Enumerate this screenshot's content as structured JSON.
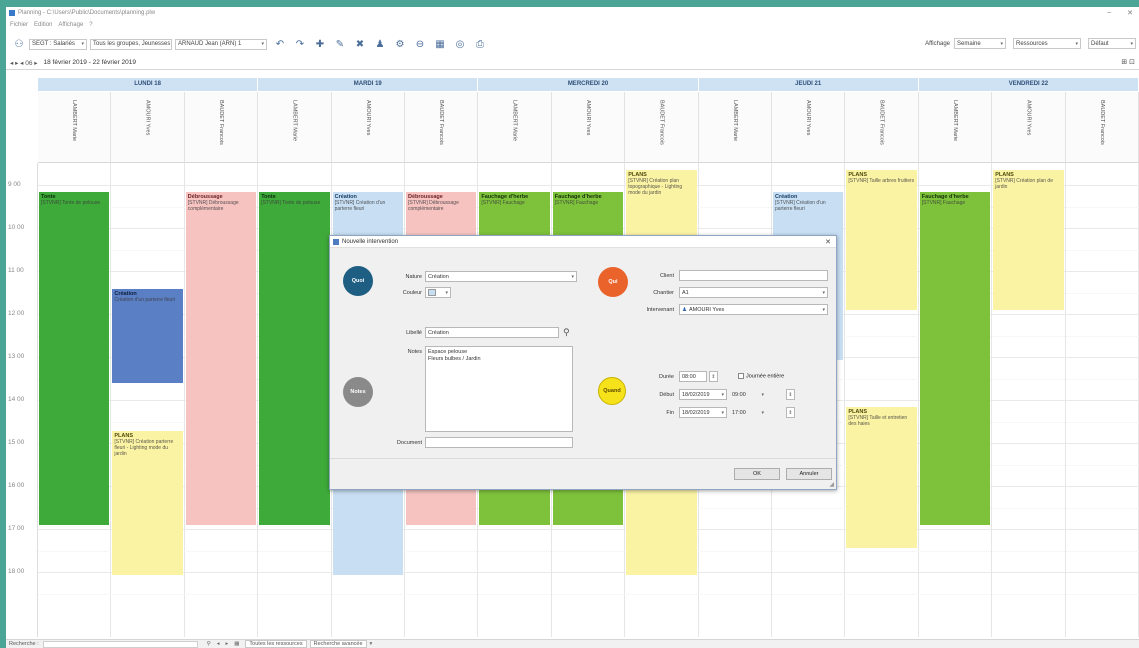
{
  "window": {
    "title": "Planning - C:\\Users\\Public\\Documents\\planning.plw",
    "minimize": "–",
    "close": "✕"
  },
  "menu": [
    "Fichier",
    "Edition",
    "Affichage",
    "?"
  ],
  "toolbar": {
    "combo1": "SEGT : Salariés",
    "combo2": "Tous les groupes, Jeunesses",
    "combo3": "ARNAUD Jean (ARN) 1",
    "right_label": "Affichage",
    "right_combo1": "Semaine",
    "right_combo2": "Ressources",
    "right_combo3": "Défaut"
  },
  "datebar": {
    "nav": "◂ ▸ ◂ 06 ▸",
    "range": "18 février 2019 - 22 février 2019",
    "corner": "⊞ ⊡"
  },
  "days": [
    "LUNDI 18",
    "MARDI 19",
    "MERCREDI 20",
    "JEUDI 21",
    "VENDREDI 22"
  ],
  "resources": [
    "LAMBERT Marie",
    "AMOURI Yves",
    "BAUDET Francois",
    "LAMBERT Marie",
    "AMOURI Yves",
    "BAUDET Francois",
    "LAMBERT Marie",
    "AMOURI Yves",
    "BAUDET Francois",
    "LAMBERT Marie",
    "AMOURI Yves",
    "BAUDET Francois",
    "LAMBERT Marie",
    "AMOURI Yves",
    "BAUDET Francois"
  ],
  "hours": [
    "9 00",
    "10 00",
    "11 00",
    "12 00",
    "13 00",
    "14 00",
    "15 00",
    "16 00",
    "17 00",
    "18 00"
  ],
  "events": {
    "lun_marie": {
      "title": "Tonte",
      "sub": "[STVNR] Tonte de pelouse"
    },
    "lun_yves": {
      "title": "Création",
      "sub": "Création d'un parterre fleuri"
    },
    "lun_yves_plan": {
      "title": "PLANS",
      "sub": "[STVNR] Création parterre fleuri - Lighting mode du jardin"
    },
    "lun_baudet": {
      "title": "Débroussage",
      "sub": "[STVNR] Débroussage complémentaire"
    },
    "mar_marie": {
      "title": "Tonte",
      "sub": "[STVNR] Tonte de pelouse"
    },
    "mar_yves": {
      "title": "Création",
      "sub": "[STVNR] Création d'un parterre fleuri"
    },
    "mar_baudet": {
      "title": "Débroussage",
      "sub": "[STVNR] Débroussage complémentaire"
    },
    "mer_marie": {
      "title": "Fauchage d'herbe",
      "sub": "[STVNR] Fauchage"
    },
    "mer_yves": {
      "title": "Fauchage d'herbe",
      "sub": "[STVNR] Fauchage"
    },
    "mer_baudet": {
      "title": "PLANS",
      "sub": "[STVNR] Création plan topographique - Lighting mode du jardin"
    },
    "jeu_yves": {
      "title": "Création",
      "sub": "[STVNR] Création d'un parterre fleuri"
    },
    "jeu_baudet": {
      "title": "PLANS",
      "sub": "[STVNR] Taille arbres fruitiers"
    },
    "jeu_baudet2": {
      "title": "PLANS",
      "sub": "[STVNR] Taille et entretien des haies"
    },
    "ven_marie": {
      "title": "Fauchage d'herbe",
      "sub": "[STVNR] Fauchage"
    },
    "ven_yves": {
      "title": "PLANS",
      "sub": "[STVNR] Création plan de jardin"
    }
  },
  "dialog": {
    "title": "Nouvelle intervention",
    "close": "✕",
    "circle_left_top": "Quoi",
    "circle_left_bottom": "Notes",
    "circle_right_top": "Qui",
    "circle_right_bottom": "Quand",
    "nature_label": "Nature",
    "nature_value": "Création",
    "couleur_label": "Couleur",
    "libelle_label": "Libellé",
    "libelle_value": "Création",
    "notes_label": "Notes",
    "notes_value": "Espace pelouse\nFleurs bulbes / Jardin",
    "document_label": "Document",
    "client_label": "Client",
    "client_value": "",
    "chantier_label": "Chantier",
    "chantier_value": "A1",
    "intervenant_label": "Intervenant",
    "intervenant_value": "AMOURI Yves",
    "duree_label": "Durée",
    "duree_value": "08:00",
    "journee_label": "Journée entière",
    "debut_label": "Début",
    "debut_date": "18/02/2019",
    "debut_time": "09:00",
    "fin_label": "Fin",
    "fin_date": "18/02/2019",
    "fin_time": "17:00",
    "ok": "OK",
    "cancel": "Annuler"
  },
  "statusbar": {
    "label": "Recherche :",
    "tab1": "Toutes les ressources",
    "tab2": "Recherche avancée"
  },
  "colors": {
    "tonte": "#3eaa3a",
    "fauchage": "#7ec23c",
    "debroussage": "#f6c3c1",
    "plans": "#fbf3a4",
    "creation": "#c7def3",
    "creation_selected": "#5b7fc4",
    "qui": "#e9632a",
    "quoi": "#1f5e83",
    "notes": "#8a8a8a",
    "quand": "#f6e21a"
  }
}
